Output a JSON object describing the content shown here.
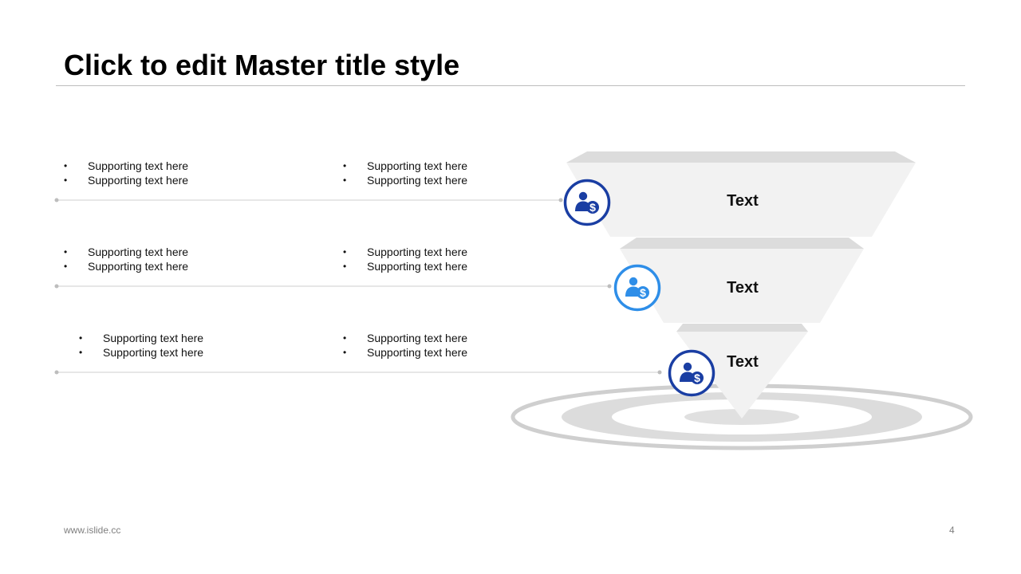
{
  "slide": {
    "title": "Click to edit Master title style",
    "footer_url": "www.islide.cc",
    "page_number": "4"
  },
  "rows": [
    {
      "left_bullets": [
        "Supporting text here",
        "Supporting text here"
      ],
      "right_bullets": [
        "Supporting text here",
        "Supporting text here"
      ],
      "funnel_label": "Text",
      "icon": "user-dollar-icon",
      "icon_color": "#1a3ea3"
    },
    {
      "left_bullets": [
        "Supporting text here",
        "Supporting text here"
      ],
      "right_bullets": [
        "Supporting text here",
        "Supporting text here"
      ],
      "funnel_label": "Text",
      "icon": "user-dollar-icon",
      "icon_color": "#2e8ee8"
    },
    {
      "left_bullets": [
        "Supporting text here",
        "Supporting text here"
      ],
      "right_bullets": [
        "Supporting text here",
        "Supporting text here"
      ],
      "funnel_label": "Text",
      "icon": "user-dollar-icon",
      "icon_color": "#1a3ea3"
    }
  ],
  "colors": {
    "connector_line": "#cfcfcf",
    "funnel_face": "#f2f2f2",
    "funnel_top": "#dcdcdc",
    "target_ring": "#d0d0d0"
  }
}
